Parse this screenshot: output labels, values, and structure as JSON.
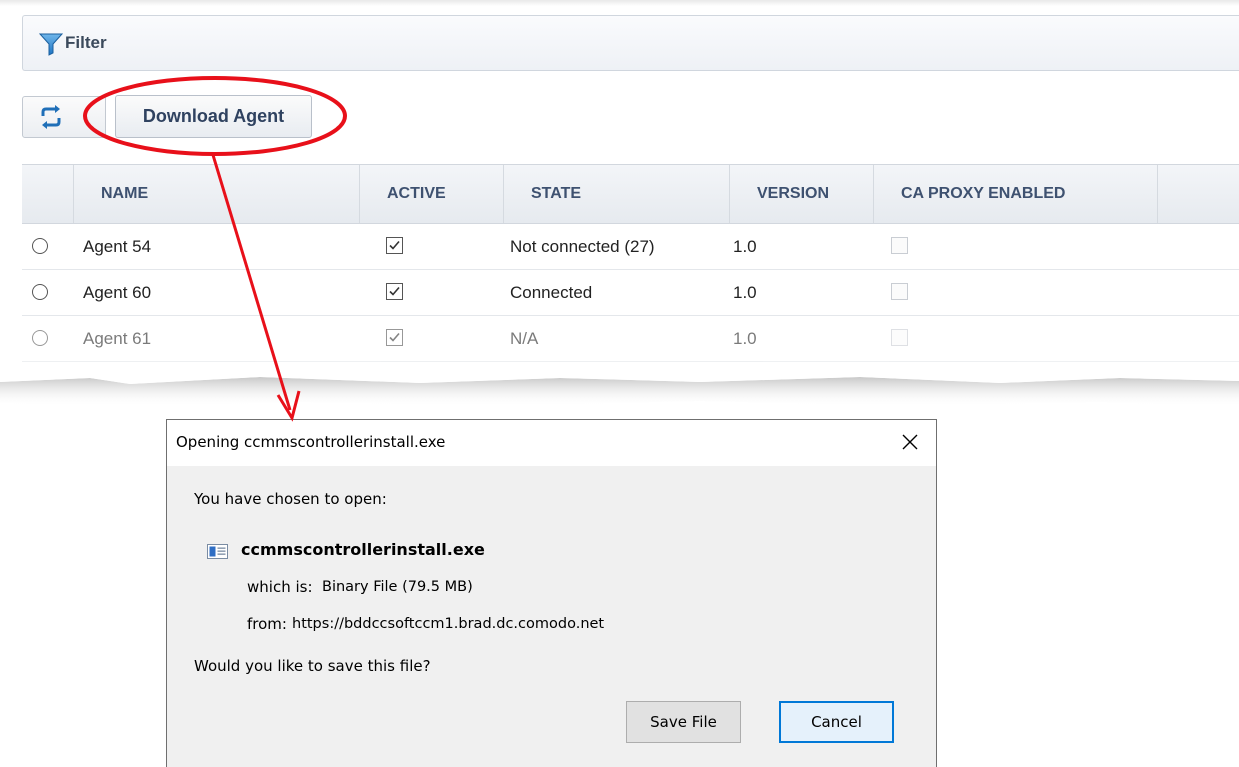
{
  "filter": {
    "label": "Filter"
  },
  "toolbar": {
    "download_label": "Download Agent"
  },
  "table": {
    "columns": [
      "NAME",
      "ACTIVE",
      "STATE",
      "VERSION",
      "CA PROXY ENABLED"
    ],
    "rows": [
      {
        "name": "Agent 54",
        "active": true,
        "state": "Not connected (27)",
        "version": "1.0",
        "ca_proxy_enabled": false
      },
      {
        "name": "Agent 60",
        "active": true,
        "state": "Connected",
        "version": "1.0",
        "ca_proxy_enabled": false
      },
      {
        "name": "Agent 61",
        "active": true,
        "state": "N/A",
        "version": "1.0",
        "ca_proxy_enabled": false
      }
    ]
  },
  "dialog": {
    "title": "Opening ccmmscontrollerinstall.exe",
    "intro": "You have chosen to open:",
    "file_name": "ccmmscontrollerinstall.exe",
    "which_is_label": "which is:",
    "which_is_value": "Binary File (79.5 MB)",
    "from_label": "from:",
    "from_value": "https://bddccsoftccm1.brad.dc.comodo.net",
    "question": "Would you like to save this file?",
    "save_label": "Save File",
    "cancel_label": "Cancel"
  },
  "colors": {
    "header_text": "#3e5170",
    "annotation": "#e8101a",
    "accent_button_border": "#0078d7"
  },
  "icons": [
    "filter-icon",
    "refresh-icon",
    "checkbox-check-icon",
    "file-icon",
    "close-icon",
    "arrow-icon"
  ]
}
